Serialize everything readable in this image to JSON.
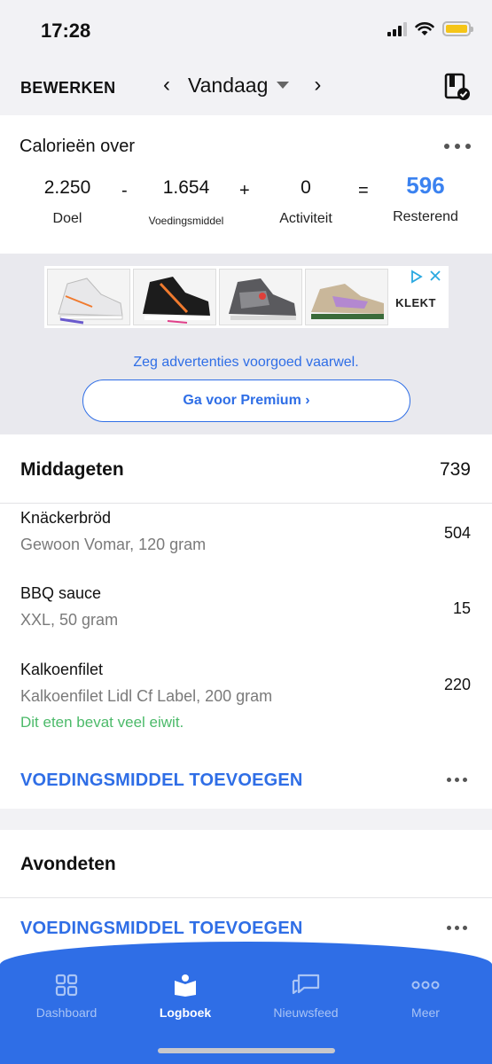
{
  "status_bar": {
    "time": "17:28"
  },
  "nav": {
    "edit_label": "BEWERKEN",
    "date_label": "Vandaag"
  },
  "calories": {
    "title": "Calorieën over",
    "goal": {
      "value": "2.250",
      "label": "Doel"
    },
    "food": {
      "value": "1.654",
      "label": "Voedingsmiddel"
    },
    "exercise": {
      "value": "0",
      "label": "Activiteit"
    },
    "remaining": {
      "value": "596",
      "label": "Resterend"
    },
    "ops": {
      "minus": "-",
      "plus": "+",
      "equals": "="
    },
    "remaining_color": "#3b82f0"
  },
  "ad": {
    "brand": "KLEKT",
    "message": "Zeg advertenties voorgoed vaarwel.",
    "premium_label": "Ga voor Premium ›"
  },
  "lunch": {
    "title": "Middageten",
    "total": "739",
    "items": [
      {
        "name": "Knäckerbröd",
        "desc": "Gewoon Vomar, 120 gram",
        "cal": "504",
        "note": ""
      },
      {
        "name": "BBQ sauce",
        "desc": "XXL, 50 gram",
        "cal": "15",
        "note": ""
      },
      {
        "name": "Kalkoenfilet",
        "desc": "Kalkoenfilet Lidl Cf Label, 200 gram",
        "cal": "220",
        "note": "Dit eten bevat veel eiwit."
      }
    ],
    "add_label": "VOEDINGSMIDDEL TOEVOEGEN"
  },
  "dinner": {
    "title": "Avondeten",
    "add_label": "VOEDINGSMIDDEL TOEVOEGEN"
  },
  "tabs": [
    {
      "label": "Dashboard",
      "icon": "dashboard-icon",
      "active": false
    },
    {
      "label": "Logboek",
      "icon": "logbook-icon",
      "active": true
    },
    {
      "label": "Nieuwsfeed",
      "icon": "newsfeed-icon",
      "active": false
    },
    {
      "label": "Meer",
      "icon": "more-icon",
      "active": false
    }
  ],
  "colors": {
    "accent": "#2f6ee6",
    "protein_note": "#4cba6a",
    "battery": "#f5c518"
  }
}
